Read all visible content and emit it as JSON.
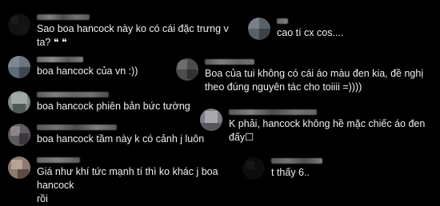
{
  "colors": {
    "background": "#000000",
    "text": "#f0f0f0",
    "username_blur": "#8a8a8a"
  },
  "comments": [
    {
      "id": "c1",
      "avatar_color": "#121212",
      "text": "Sao boa hancock này ko có cái đặc trưng v ta? ❝ ❝"
    },
    {
      "id": "c2",
      "avatar_color": "#5f6b74",
      "text": "boa hancock của vn :))"
    },
    {
      "id": "c3",
      "avatar_color": "#7c8a86",
      "text": "boa hancock phiên bản bức tường"
    },
    {
      "id": "c4",
      "avatar_color": "#5e5a60",
      "text": "boa hancock tầm này k có cảnh j luôn"
    },
    {
      "id": "c5",
      "avatar_color": "#8e7a70",
      "text": "Giá như khí tức mạnh tí thì ko khác j boa hancock\nrồi"
    },
    {
      "id": "c6",
      "avatar_color": "#5a6068",
      "text": "cao tí cx cos...."
    },
    {
      "id": "c7",
      "avatar_color": "#4c4c4c",
      "text": "Boa của tui không có cái áo màu đen kia, đề nghị\ntheo đúng nguyên tác cho toiiii =))))"
    },
    {
      "id": "c8",
      "avatar_color": "#7d7f85",
      "text": "K phải, hancock không hề mặc chiếc áo đen đấy☐"
    },
    {
      "id": "c9",
      "avatar_color": "#0c0c0c",
      "text": "t thấy 6.."
    }
  ]
}
